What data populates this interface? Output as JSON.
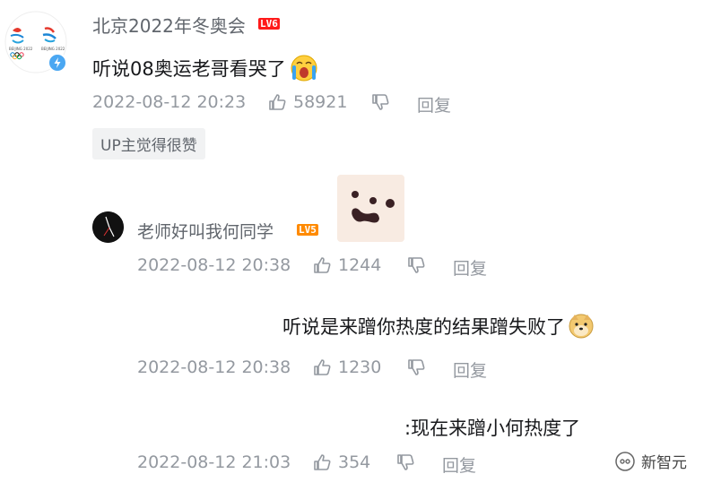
{
  "comment": {
    "username": "北京2022年冬奥会",
    "level": "LV6",
    "text": "听说08奥运老哥看哭了",
    "time": "2022-08-12 20:23",
    "likes": "58921",
    "reply_label": "回复",
    "tag": "UP主觉得很赞"
  },
  "replies": [
    {
      "username": "老师好叫我何同学",
      "level": "LV5",
      "time": "2022-08-12 20:38",
      "likes": "1244",
      "reply_label": "回复"
    },
    {
      "text": "听说是来蹭你热度的结果蹭失败了",
      "time": "2022-08-12 20:38",
      "likes": "1230",
      "reply_label": "回复"
    },
    {
      "text": ":现在来蹭小何热度了",
      "time": "2022-08-12 21:03",
      "likes": "354",
      "reply_label": "回复"
    }
  ],
  "watermark": "新智元",
  "emojis": [
    "crying-emoji",
    "doge-emoji",
    "sticker-face"
  ],
  "colors": {
    "level6": "#ff1a1a",
    "level5": "#ff8a00",
    "meta": "#9499a0",
    "tag_bg": "#f1f2f3"
  }
}
